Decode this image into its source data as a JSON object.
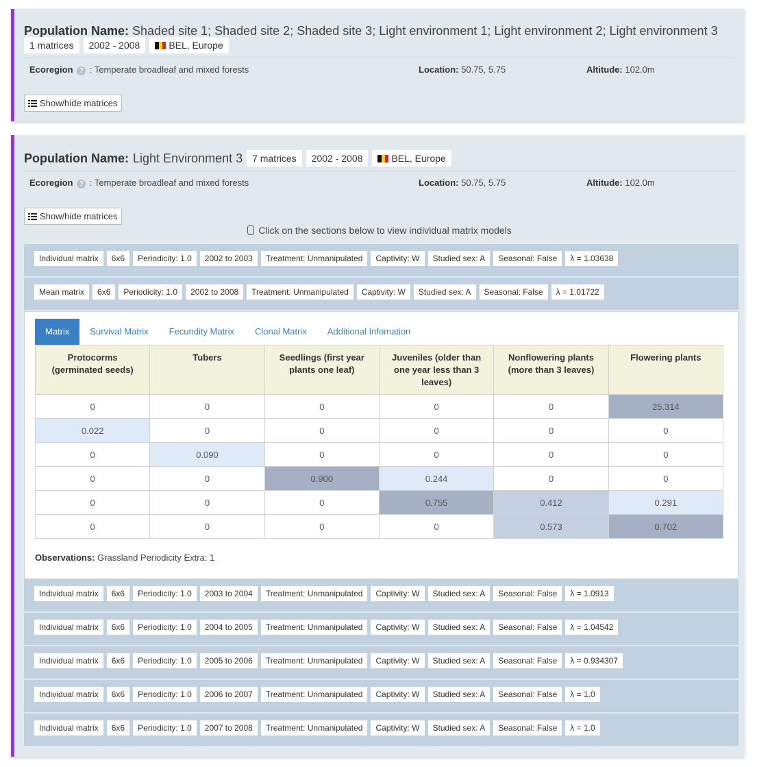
{
  "populations": [
    {
      "label": "Population Name:",
      "name": "Shaded site 1; Shaded site 2; Shaded site 3; Light environment 1; Light environment 2; Light environment 3",
      "matrices": "1 matrices",
      "years": "2002 - 2008",
      "country": "BEL, Europe",
      "ecoregion_label": "Ecoregion",
      "ecoregion": ": Temperate broadleaf and mixed forests",
      "location_label": "Location:",
      "location": "50.75, 5.75",
      "altitude_label": "Altitude:",
      "altitude": "102.0m",
      "toggle_label": "Show/hide matrices"
    },
    {
      "label": "Population Name:",
      "name": "Light Environment 3",
      "matrices": "7 matrices",
      "years": "2002 - 2008",
      "country": "BEL, Europe",
      "ecoregion_label": "Ecoregion",
      "ecoregion": ": Temperate broadleaf and mixed forests",
      "location_label": "Location:",
      "location": "50.75, 5.75",
      "altitude_label": "Altitude:",
      "altitude": "102.0m",
      "toggle_label": "Show/hide matrices",
      "hint": "Click on the sections below to view individual matrix models"
    }
  ],
  "matrix_rows": [
    {
      "type": "Individual matrix",
      "size": "6x6",
      "periodicity": "Periodicity: 1.0",
      "period": "2002 to 2003",
      "treatment": "Treatment: Unmanipulated",
      "captivity": "Captivity: W",
      "sex": "Studied sex: A",
      "seasonal": "Seasonal: False",
      "lambda": "λ = 1.03638"
    },
    {
      "type": "Mean matrix",
      "size": "6x6",
      "periodicity": "Periodicity: 1.0",
      "period": "2002 to 2008",
      "treatment": "Treatment: Unmanipulated",
      "captivity": "Captivity: W",
      "sex": "Studied sex: A",
      "seasonal": "Seasonal: False",
      "lambda": "λ = 1.01722"
    },
    {
      "type": "Individual matrix",
      "size": "6x6",
      "periodicity": "Periodicity: 1.0",
      "period": "2003 to 2004",
      "treatment": "Treatment: Unmanipulated",
      "captivity": "Captivity: W",
      "sex": "Studied sex: A",
      "seasonal": "Seasonal: False",
      "lambda": "λ = 1.0913"
    },
    {
      "type": "Individual matrix",
      "size": "6x6",
      "periodicity": "Periodicity: 1.0",
      "period": "2004 to 2005",
      "treatment": "Treatment: Unmanipulated",
      "captivity": "Captivity: W",
      "sex": "Studied sex: A",
      "seasonal": "Seasonal: False",
      "lambda": "λ = 1.04542"
    },
    {
      "type": "Individual matrix",
      "size": "6x6",
      "periodicity": "Periodicity: 1.0",
      "period": "2005 to 2006",
      "treatment": "Treatment: Unmanipulated",
      "captivity": "Captivity: W",
      "sex": "Studied sex: A",
      "seasonal": "Seasonal: False",
      "lambda": "λ = 0.934307"
    },
    {
      "type": "Individual matrix",
      "size": "6x6",
      "periodicity": "Periodicity: 1.0",
      "period": "2006 to 2007",
      "treatment": "Treatment: Unmanipulated",
      "captivity": "Captivity: W",
      "sex": "Studied sex: A",
      "seasonal": "Seasonal: False",
      "lambda": "λ = 1.0"
    },
    {
      "type": "Individual matrix",
      "size": "6x6",
      "periodicity": "Periodicity: 1.0",
      "period": "2007 to 2008",
      "treatment": "Treatment: Unmanipulated",
      "captivity": "Captivity: W",
      "sex": "Studied sex: A",
      "seasonal": "Seasonal: False",
      "lambda": "λ = 1.0"
    }
  ],
  "tabs": [
    "Matrix",
    "Survival Matrix",
    "Fecundity Matrix",
    "Clonal Matrix",
    "Additional Infomation"
  ],
  "active_tab": "Matrix",
  "matrix": {
    "headers": [
      "Protocorms (germinated seeds)",
      "Tubers",
      "Seedlings (first year plants one leaf)",
      "Juveniles (older than one year less than 3 leaves)",
      "Nonflowering plants (more than 3 leaves)",
      "Flowering plants"
    ],
    "rows": [
      [
        "0",
        "0",
        "0",
        "0",
        "0",
        "25.314"
      ],
      [
        "0.022",
        "0",
        "0",
        "0",
        "0",
        "0"
      ],
      [
        "0",
        "0.090",
        "0",
        "0",
        "0",
        "0"
      ],
      [
        "0",
        "0",
        "0.900",
        "0.244",
        "0",
        "0"
      ],
      [
        "0",
        "0",
        "0",
        "0.755",
        "0.412",
        "0.291"
      ],
      [
        "0",
        "0",
        "0",
        "0",
        "0.573",
        "0.702"
      ]
    ],
    "shading": [
      [
        "",
        "",
        "",
        "",
        "",
        "hi"
      ],
      [
        "lo",
        "",
        "",
        "",
        "",
        ""
      ],
      [
        "",
        "lo",
        "",
        "",
        "",
        ""
      ],
      [
        "",
        "",
        "hi",
        "lo",
        "",
        ""
      ],
      [
        "",
        "",
        "",
        "hi",
        "mid",
        "lo"
      ],
      [
        "",
        "",
        "",
        "",
        "mid",
        "hi"
      ]
    ]
  },
  "observations_label": "Observations:",
  "observations": "Grassland Periodicity Extra: 1",
  "colors": {
    "accent_border": "#8b3fc9",
    "card_bg": "#e1e8ee",
    "row_bg": "#c2d1e0",
    "tab_active": "#3a7fc4",
    "header_bg": "#f3f3dd"
  },
  "icons": {
    "help": "question-circle-icon",
    "flag": "belgium-flag-icon",
    "list": "list-icon",
    "hand": "hand-pointer-icon"
  }
}
